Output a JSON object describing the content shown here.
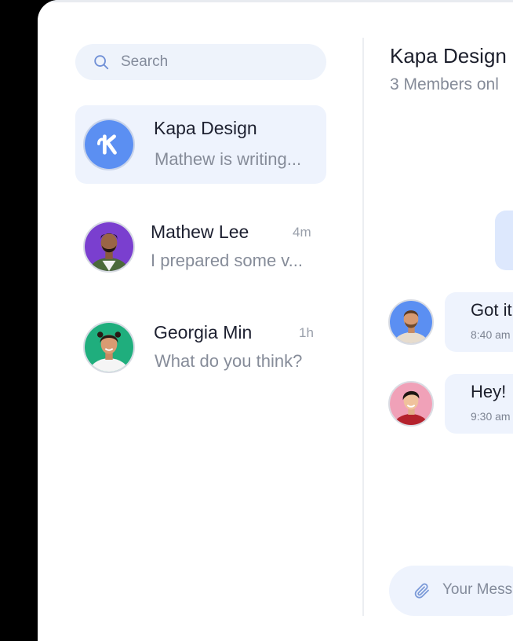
{
  "search": {
    "placeholder": "Search",
    "icon": "search-icon"
  },
  "conversations": [
    {
      "name": "Kapa Design",
      "preview": "Mathew is writing...",
      "time": "",
      "active": true,
      "avatar": "kapa-logo"
    },
    {
      "name": "Mathew Lee",
      "preview": "I prepared some v...",
      "time": "4m",
      "active": false,
      "avatar": "person-bearded-purple-bg"
    },
    {
      "name": "Georgia Min",
      "preview": "What do you think?",
      "time": "1h",
      "active": false,
      "avatar": "person-woman-green-bg"
    }
  ],
  "chat": {
    "title": "Kapa Design",
    "subtitle": "3 Members onl",
    "messages": [
      {
        "text": "Got it",
        "time": "8:40 am",
        "avatar": "person-bearded-blue-bg"
      },
      {
        "text": "Hey!",
        "time": "9:30 am",
        "avatar": "person-young-pink-bg"
      }
    ],
    "composer_placeholder": "Your Mess",
    "attach_icon": "paperclip-icon"
  },
  "colors": {
    "accent": "#5b8ff2",
    "active_bg": "#eef3fd",
    "outgoing_bubble": "#dde8fd",
    "text_primary": "#1d2030",
    "text_secondary": "#868c99"
  }
}
